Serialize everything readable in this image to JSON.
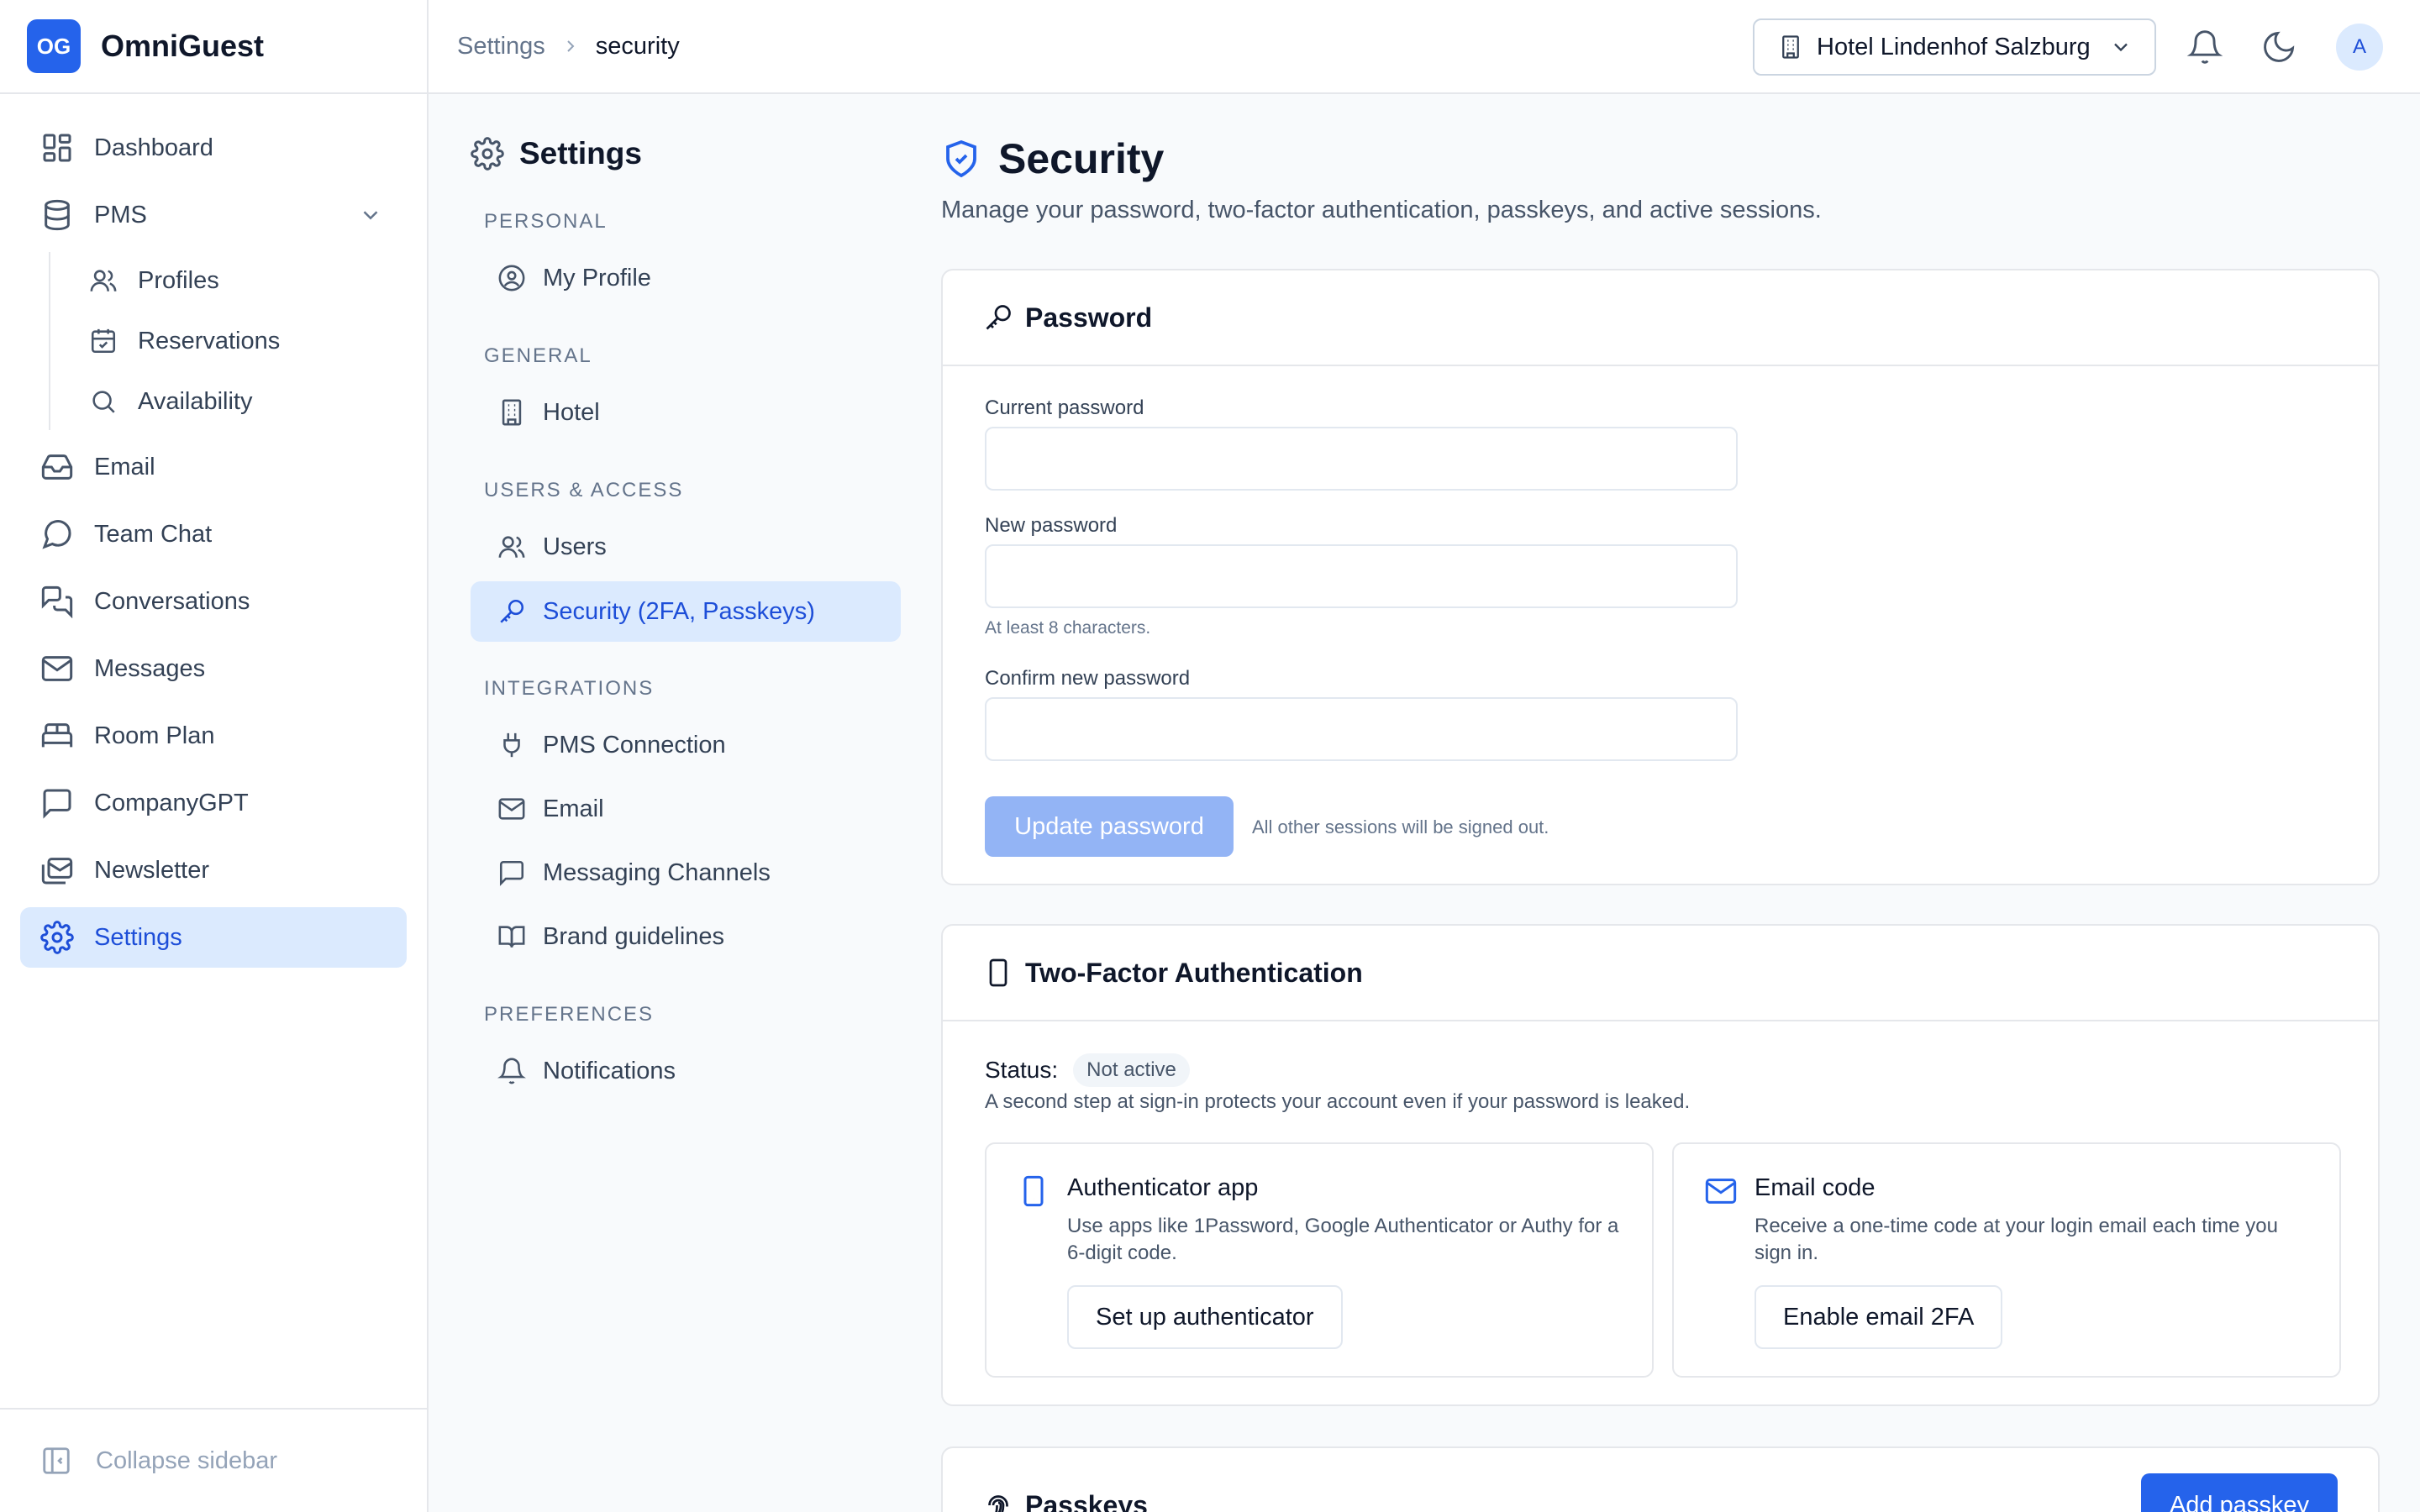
{
  "brand": {
    "logo_text": "OG",
    "name": "OmniGuest"
  },
  "sidebar": {
    "items": [
      {
        "label": "Dashboard",
        "icon": "layout-grid-icon"
      },
      {
        "label": "PMS",
        "icon": "database-icon",
        "expanded": true
      },
      {
        "label": "Profiles",
        "icon": "users-icon"
      },
      {
        "label": "Reservations",
        "icon": "calendar-check-icon"
      },
      {
        "label": "Availability",
        "icon": "search-icon"
      },
      {
        "label": "Email",
        "icon": "inbox-icon"
      },
      {
        "label": "Team Chat",
        "icon": "message-circle-icon"
      },
      {
        "label": "Conversations",
        "icon": "messages-icon"
      },
      {
        "label": "Messages",
        "icon": "mail-icon"
      },
      {
        "label": "Room Plan",
        "icon": "bed-icon"
      },
      {
        "label": "CompanyGPT",
        "icon": "message-square-icon"
      },
      {
        "label": "Newsletter",
        "icon": "mails-icon"
      },
      {
        "label": "Settings",
        "icon": "gear-icon",
        "active": true
      }
    ],
    "collapse_label": "Collapse sidebar"
  },
  "topbar": {
    "breadcrumb": [
      "Settings",
      "security"
    ],
    "hotel": "Hotel Lindenhof Salzburg",
    "avatar": "A"
  },
  "settings_nav": {
    "title": "Settings",
    "groups": [
      {
        "label": "PERSONAL",
        "items": [
          "My Profile"
        ]
      },
      {
        "label": "GENERAL",
        "items": [
          "Hotel"
        ]
      },
      {
        "label": "USERS & ACCESS",
        "items": [
          "Users",
          "Security (2FA, Passkeys)"
        ]
      },
      {
        "label": "INTEGRATIONS",
        "items": [
          "PMS Connection",
          "Email",
          "Messaging Channels",
          "Brand guidelines"
        ]
      },
      {
        "label": "PREFERENCES",
        "items": [
          "Notifications"
        ]
      }
    ],
    "active_item": "Security (2FA, Passkeys)"
  },
  "page": {
    "title": "Security",
    "subtitle": "Manage your password, two-factor authentication, passkeys, and active sessions."
  },
  "password": {
    "title": "Password",
    "current_label": "Current password",
    "current_value": "",
    "new_label": "New password",
    "new_value": "",
    "new_hint": "At least 8 characters.",
    "confirm_label": "Confirm new password",
    "confirm_value": "",
    "button": "Update password",
    "note": "All other sessions will be signed out."
  },
  "twofa": {
    "title": "Two-Factor Authentication",
    "status_label": "Status:",
    "status": "Not active",
    "description": "A second step at sign-in protects your account even if your password is leaked.",
    "options": [
      {
        "title": "Authenticator app",
        "description": "Use apps like 1Password, Google Authenticator or Authy for a 6-digit code.",
        "button": "Set up authenticator"
      },
      {
        "title": "Email code",
        "description": "Receive a one-time code at your login email each time you sign in.",
        "button": "Enable email 2FA"
      }
    ]
  },
  "passkeys": {
    "title": "Passkeys",
    "button": "Add passkey"
  },
  "colors": {
    "accent": "#2563eb",
    "active_bg": "#dbeafe",
    "disabled_button": "#93b4f5"
  }
}
